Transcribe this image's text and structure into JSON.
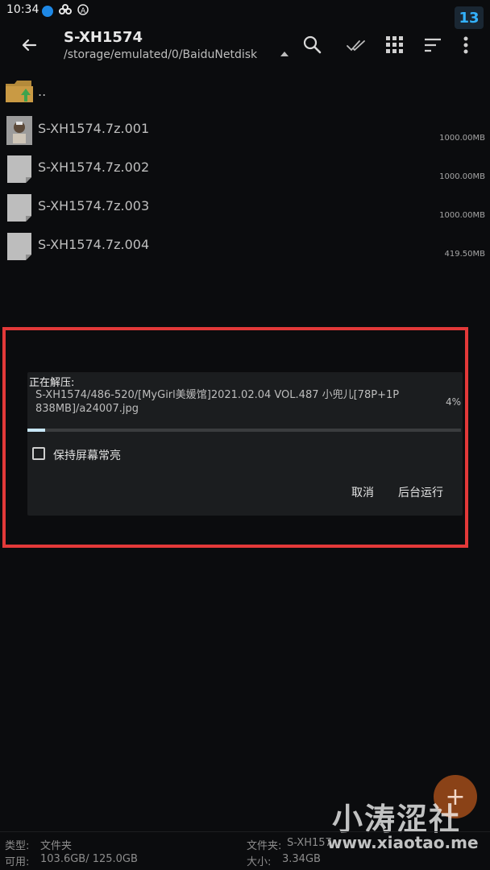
{
  "status_bar": {
    "time": "10:34",
    "badge": "13"
  },
  "header": {
    "title": "S-XH1574",
    "path": "/storage/emulated/0/BaiduNetdisk"
  },
  "files": [
    {
      "name": "..",
      "size": "",
      "icon": "folder-up-icon"
    },
    {
      "name": "S-XH1574.7z.001",
      "size": "1000.00MB",
      "icon": "image-thumb"
    },
    {
      "name": "S-XH1574.7z.002",
      "size": "1000.00MB",
      "icon": "file-icon"
    },
    {
      "name": "S-XH1574.7z.003",
      "size": "1000.00MB",
      "icon": "file-icon"
    },
    {
      "name": "S-XH1574.7z.004",
      "size": "419.50MB",
      "icon": "file-icon"
    }
  ],
  "dialog": {
    "title": "正在解压:",
    "path": "S-XH1574/486-520/[MyGirl美媛馆]2021.02.04 VOL.487 小兜儿[78P+1P 838MB]/a24007.jpg",
    "percent": "4%",
    "progress": 0.04,
    "checkbox_label": "保持屏幕常亮",
    "cancel_label": "取消",
    "background_label": "后台运行"
  },
  "bottom_info": {
    "type_label": "类型:",
    "type_value": "文件夹",
    "avail_label": "可用:",
    "avail_value": "103.6GB/ 125.0GB",
    "folder_label": "文件夹:",
    "folder_value": "S-XH157",
    "size_label": "大小:",
    "size_value": "3.34GB"
  },
  "fab": {
    "symbol": "+"
  },
  "watermark": {
    "main": "小涛涩社",
    "url": "www.xiaotao.me"
  },
  "colors": {
    "highlight_border": "#e33939",
    "accent": "#33b2ff",
    "fab": "#8a4217"
  }
}
